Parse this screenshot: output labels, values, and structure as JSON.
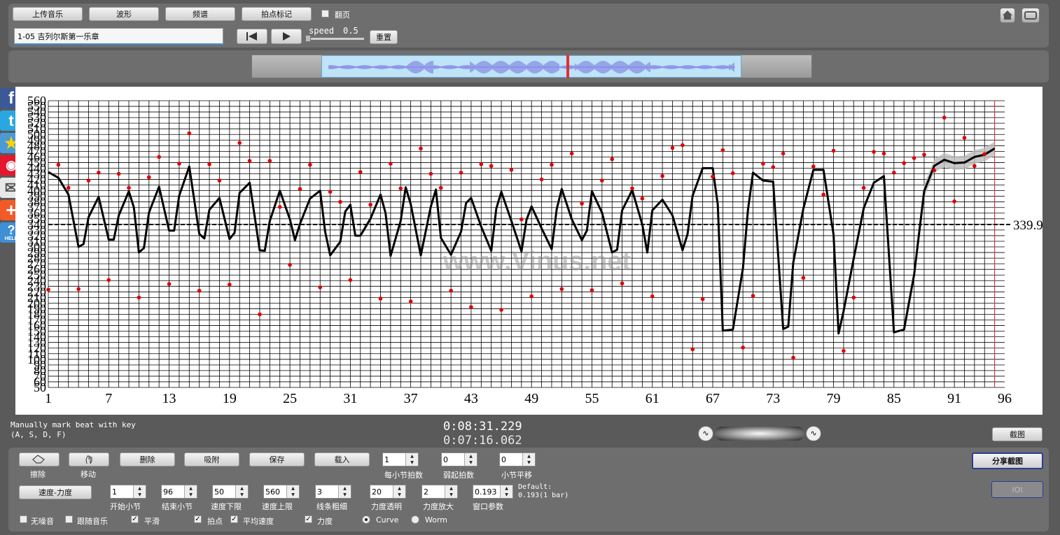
{
  "toolbar": {
    "upload_music": "上传音乐",
    "waveform": "波形",
    "spectrum": "频谱",
    "beat_mark": "拍点标记",
    "page_flip": "翻页",
    "track_title": "1-05 吉列尔斯第一乐章",
    "speed_label": "speed",
    "speed_value": "0.5",
    "reset": "重置"
  },
  "social": {
    "icons": [
      "facebook-icon",
      "twitter-icon",
      "favorite-star-icon",
      "weibo-icon",
      "email-icon",
      "add-plus-icon",
      "help-icon"
    ],
    "help_text": "HELP"
  },
  "watermark": "www.Vinus.net",
  "chart_data": {
    "type": "line",
    "y_ticks": [
      50,
      60,
      70,
      80,
      90,
      100,
      110,
      120,
      130,
      140,
      150,
      160,
      170,
      180,
      190,
      200,
      210,
      220,
      230,
      240,
      250,
      260,
      270,
      280,
      290,
      300,
      310,
      320,
      330,
      340,
      350,
      360,
      370,
      380,
      390,
      400,
      410,
      420,
      430,
      440,
      450,
      460,
      470,
      480,
      490,
      500,
      510,
      520,
      530,
      540,
      550,
      560
    ],
    "x_ticks": [
      1,
      7,
      13,
      19,
      25,
      31,
      37,
      43,
      49,
      55,
      61,
      67,
      73,
      79,
      85,
      91,
      96
    ],
    "ylim": [
      50,
      560
    ],
    "xlim": [
      1,
      96
    ],
    "average_value": "339.9",
    "average": 339.9,
    "end_marker_x": 95,
    "series": [
      {
        "values_x": [
          1,
          2,
          3,
          4,
          4.5,
          5,
          6,
          7,
          7.5,
          8,
          9,
          9.5,
          10,
          10.5,
          11,
          12,
          13,
          13.5,
          14,
          15,
          16,
          16.5,
          17,
          18,
          19,
          19.5,
          20,
          21,
          22,
          22.5,
          23,
          24,
          25,
          25.5,
          26,
          27,
          28,
          28.5,
          29,
          30,
          30.5,
          31,
          31.5,
          32,
          33,
          34,
          34.5,
          35,
          36,
          36.5,
          37,
          38,
          39,
          39.5,
          40,
          41,
          42,
          42.5,
          43,
          44,
          45,
          45.5,
          46,
          47,
          48,
          48.5,
          49,
          50,
          51,
          51.5,
          52,
          53,
          54,
          54.5,
          55,
          56,
          57,
          57.5,
          58,
          59,
          60,
          60.5,
          61,
          62,
          63,
          64,
          64.5,
          65,
          66,
          67,
          67.5,
          68,
          69,
          70,
          70.5,
          71,
          72,
          73,
          74,
          74.5,
          75,
          76,
          77,
          78,
          79,
          79.5,
          80,
          81,
          82,
          83,
          84,
          85,
          86,
          87,
          88,
          89,
          90,
          91,
          92,
          93,
          94,
          95
        ],
        "values": [
          433,
          423,
          393,
          300,
          305,
          353,
          389,
          313,
          313,
          356,
          399,
          370,
          290,
          298,
          361,
          407,
          329,
          329,
          391,
          443,
          323,
          315,
          366,
          387,
          314,
          325,
          396,
          414,
          294,
          293,
          346,
          400,
          349,
          312,
          341,
          386,
          400,
          327,
          285,
          309,
          363,
          375,
          320,
          320,
          350,
          393,
          360,
          284,
          346,
          406,
          376,
          285,
          372,
          402,
          316,
          286,
          327,
          378,
          387,
          336,
          293,
          368,
          398,
          346,
          292,
          348,
          372,
          333,
          296,
          367,
          403,
          349,
          312,
          329,
          399,
          361,
          290,
          295,
          365,
          401,
          340,
          290,
          365,
          384,
          356,
          294,
          323,
          391,
          440,
          440,
          375,
          151,
          153,
          262,
          366,
          432,
          418,
          416,
          154,
          158,
          272,
          368,
          437,
          437,
          322,
          146,
          186,
          279,
          369,
          414,
          426,
          148,
          153,
          250,
          399,
          444,
          455,
          449,
          450,
          460,
          464,
          475,
          485,
          442,
          454,
          456,
          440,
          398
        ]
      }
    ],
    "scatter": [
      [
        1,
        224
      ],
      [
        2,
        446
      ],
      [
        3,
        405
      ],
      [
        4,
        225
      ],
      [
        5,
        418
      ],
      [
        6,
        432
      ],
      [
        7,
        241
      ],
      [
        8,
        430
      ],
      [
        9,
        405
      ],
      [
        10,
        210
      ],
      [
        11,
        424
      ],
      [
        12,
        460
      ],
      [
        13,
        234
      ],
      [
        14,
        448
      ],
      [
        15,
        502
      ],
      [
        16,
        222
      ],
      [
        17,
        447
      ],
      [
        18,
        418
      ],
      [
        19,
        233
      ],
      [
        20,
        485
      ],
      [
        21,
        453
      ],
      [
        22,
        180
      ],
      [
        23,
        453
      ],
      [
        24,
        371
      ],
      [
        25,
        268
      ],
      [
        26,
        403
      ],
      [
        27,
        446
      ],
      [
        28,
        228
      ],
      [
        29,
        398
      ],
      [
        30,
        380
      ],
      [
        31,
        241
      ],
      [
        32,
        433
      ],
      [
        33,
        375
      ],
      [
        34,
        208
      ],
      [
        35,
        448
      ],
      [
        36,
        404
      ],
      [
        37,
        203
      ],
      [
        38,
        475
      ],
      [
        39,
        430
      ],
      [
        40,
        405
      ],
      [
        41,
        222
      ],
      [
        42,
        432
      ],
      [
        43,
        193
      ],
      [
        44,
        447
      ],
      [
        45,
        444
      ],
      [
        46,
        188
      ],
      [
        47,
        437
      ],
      [
        48,
        349
      ],
      [
        49,
        212
      ],
      [
        50,
        420
      ],
      [
        51,
        446
      ],
      [
        52,
        225
      ],
      [
        53,
        466
      ],
      [
        54,
        377
      ],
      [
        55,
        223
      ],
      [
        56,
        418
      ],
      [
        57,
        456
      ],
      [
        58,
        235
      ],
      [
        59,
        404
      ],
      [
        60,
        386
      ],
      [
        61,
        212
      ],
      [
        62,
        426
      ],
      [
        63,
        476
      ],
      [
        64,
        481
      ],
      [
        65,
        118
      ],
      [
        66,
        207
      ],
      [
        67,
        425
      ],
      [
        68,
        472
      ],
      [
        69,
        431
      ],
      [
        70,
        121
      ],
      [
        71,
        213
      ],
      [
        72,
        448
      ],
      [
        73,
        442
      ],
      [
        74,
        466
      ],
      [
        75,
        103
      ],
      [
        76,
        245
      ],
      [
        77,
        443
      ],
      [
        78,
        393
      ],
      [
        79,
        471
      ],
      [
        80,
        115
      ],
      [
        81,
        210
      ],
      [
        82,
        405
      ],
      [
        83,
        469
      ],
      [
        84,
        466
      ],
      [
        85,
        432
      ],
      [
        86,
        449
      ],
      [
        87,
        458
      ],
      [
        88,
        464
      ],
      [
        89,
        436
      ],
      [
        90,
        530
      ],
      [
        91,
        381
      ],
      [
        92,
        494
      ],
      [
        93,
        444
      ],
      [
        94,
        465
      ]
    ]
  },
  "status": {
    "hint_line1": "Manually mark beat with key",
    "hint_line2": "(A, S, D, F)",
    "time1": "0:08:31.229",
    "time2": "0:07:16.062",
    "screenshot": "截图"
  },
  "controls": {
    "erase": "擦除",
    "move": "移动",
    "delete": "删除",
    "snap": "吸附",
    "save": "保存",
    "load": "载入",
    "beats_per_bar_value": "1",
    "beats_per_bar_label": "每小节拍数",
    "pickup_value": "0",
    "pickup_label": "弱起拍数",
    "bar_shift_value": "0",
    "bar_shift_label": "小节平移",
    "share_screenshot": "分享截图",
    "io_label": "IOI",
    "mode_button": "速度-力度",
    "start_bar_value": "1",
    "start_bar_label": "开始小节",
    "end_bar_value": "96",
    "end_bar_label": "结束小节",
    "speed_min_value": "50",
    "speed_min_label": "速度下限",
    "speed_max_value": "560",
    "speed_max_label": "速度上限",
    "line_width_value": "3",
    "line_width_label": "线条粗细",
    "dyn_alpha_value": "20",
    "dyn_alpha_label": "力度透明",
    "dyn_scale_value": "2",
    "dyn_scale_label": "力度放大",
    "window_value": "0.193",
    "window_label": "窗口参数",
    "default_line1": "Default:",
    "default_line2": "0.193(1 bar)",
    "no_noise": "无噪音",
    "follow_music": "跟随音乐",
    "smooth": "平滑",
    "beat_points": "拍点",
    "avg_speed": "平均速度",
    "dynamics": "力度",
    "curve": "Curve",
    "worm": "Worm"
  }
}
